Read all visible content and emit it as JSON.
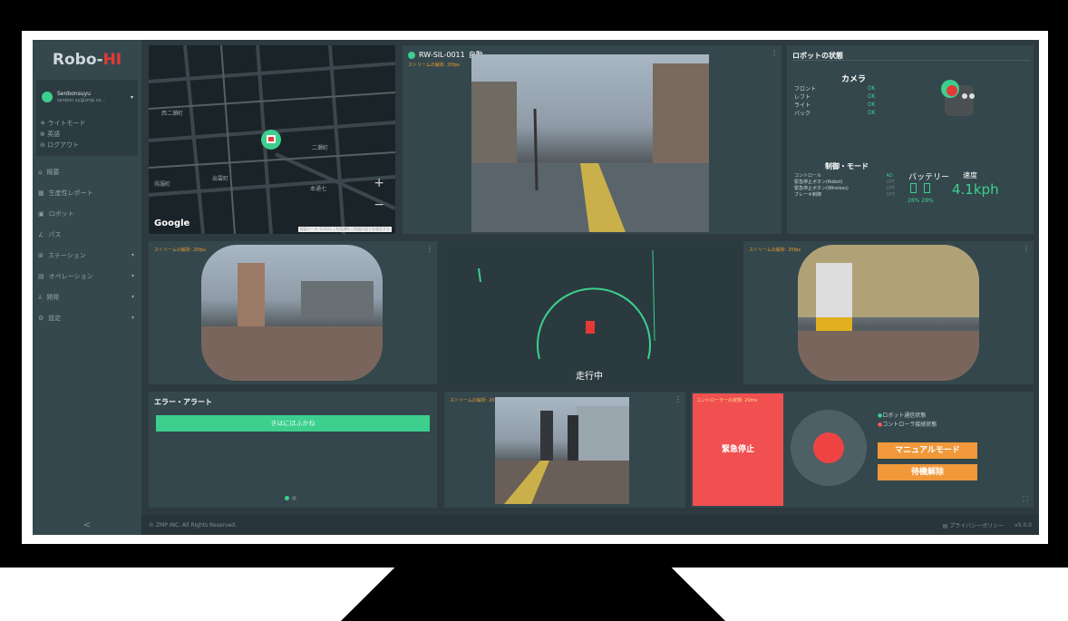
{
  "app": {
    "logo_main": "Robo-",
    "logo_accent": "HI"
  },
  "user": {
    "name": "Senbonsuyu",
    "email": "senbon.sy@zmp.co..."
  },
  "user_menu": [
    {
      "icon": "light-icon",
      "label": "ライトモード"
    },
    {
      "icon": "globe-icon",
      "label": "英語"
    },
    {
      "icon": "logout-icon",
      "label": "ログアウト"
    }
  ],
  "nav": [
    {
      "icon": "home-icon",
      "label": "概要"
    },
    {
      "icon": "chart-icon",
      "label": "生産性レポート"
    },
    {
      "icon": "robot-icon",
      "label": "ロボット"
    },
    {
      "icon": "path-icon",
      "label": "パス"
    },
    {
      "icon": "station-icon",
      "label": "ステーション",
      "expandable": true
    },
    {
      "icon": "operation-icon",
      "label": "オペレーション",
      "expandable": true
    },
    {
      "icon": "dev-icon",
      "label": "開発",
      "expandable": true
    },
    {
      "icon": "settings-icon",
      "label": "設定",
      "expandable": true
    }
  ],
  "collapse_label": "<",
  "map": {
    "provider": "Google",
    "labels": [
      "西二瀬町",
      "二瀬町",
      "出雲町",
      "本通七",
      "呉服町"
    ],
    "zoom_in": "+",
    "zoom_out": "−",
    "attribution": "地図データ ©2021 | 利用規約 | 地図の誤りを報告する"
  },
  "main_camera": {
    "robot_id": "RW-SIL-0011",
    "status_label": "自動",
    "stream_label": "ストリームの解析: 20fps",
    "status_color": "#3ccf8e"
  },
  "robot_status": {
    "title": "ロボットの状態",
    "camera_title": "カメラ",
    "cameras": [
      {
        "name": "フロント",
        "status": "OK"
      },
      {
        "name": "レフト",
        "status": "OK"
      },
      {
        "name": "ライト",
        "status": "OK"
      },
      {
        "name": "バック",
        "status": "OK"
      }
    ],
    "control_title": "制御・モード",
    "controls": [
      {
        "name": "コントロール",
        "value": "AD"
      },
      {
        "name": "緊急停止ボタン(Robot)",
        "value": "OFF"
      },
      {
        "name": "緊急停止ボタン(Wireless)",
        "value": "OFF"
      },
      {
        "name": "ブレーキ制御",
        "value": "OFF"
      }
    ],
    "battery_label": "バッテリー",
    "battery_values": [
      "28%",
      "28%"
    ],
    "speed_label": "速度",
    "speed_value": "4.1kph"
  },
  "left_camera": {
    "stream_label": "ストリームの解析: 20fps"
  },
  "right_camera": {
    "stream_label": "ストリームの解析: 20fps"
  },
  "lidar": {
    "status_text": "走行中"
  },
  "back_camera": {
    "stream_label": "ストリームの解析: 20fps"
  },
  "alerts": {
    "title": "エラー・アラート",
    "bar_text": "きはにほふかね"
  },
  "control_panel": {
    "stream_label": "コントローラーの状態: 20ms",
    "estop_label": "緊急停止",
    "robot_comm_label": "ロボット通信状態",
    "controller_comm_label": "コントローラ接続状態",
    "manual_mode_label": "マニュアルモード",
    "standby_release_label": "待機解除",
    "robot_comm_color": "#3ccf8e",
    "controller_comm_color": "#ff5a5a"
  },
  "footer": {
    "copyright": "© ZMP INC. All Rights Reserved.",
    "privacy": "プライバシーポリシー",
    "version": "v5.0.0"
  }
}
